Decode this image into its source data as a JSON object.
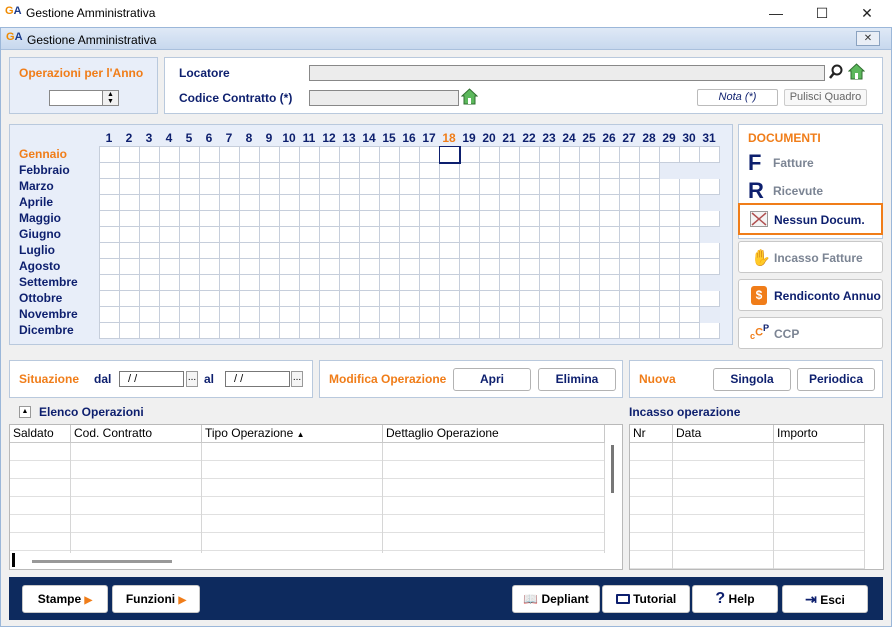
{
  "window": {
    "title": "Gestione Amministrativa",
    "min": "—",
    "max": "☐",
    "close": "✕"
  },
  "inner_window": {
    "title": "Gestione Amministrativa",
    "close": "✕"
  },
  "operazioni_anno": {
    "label": "Operazioni per l'Anno",
    "value": ""
  },
  "header": {
    "locatore_label": "Locatore",
    "locatore_value": "",
    "codice_label": "Codice Contratto (*)",
    "codice_value": "",
    "nota_button": "Nota (*)",
    "pulisci_button": "Pulisci Quadro"
  },
  "calendar": {
    "days": [
      "1",
      "2",
      "3",
      "4",
      "5",
      "6",
      "7",
      "8",
      "9",
      "10",
      "11",
      "12",
      "13",
      "14",
      "15",
      "16",
      "17",
      "18",
      "19",
      "20",
      "21",
      "22",
      "23",
      "24",
      "25",
      "26",
      "27",
      "28",
      "29",
      "30",
      "31"
    ],
    "highlight_day": "18",
    "months": [
      "Gennaio",
      "Febbraio",
      "Marzo",
      "Aprile",
      "Maggio",
      "Giugno",
      "Luglio",
      "Agosto",
      "Settembre",
      "Ottobre",
      "Novembre",
      "Dicembre"
    ],
    "highlight_month": "Gennaio",
    "month_lengths": [
      31,
      28,
      31,
      30,
      31,
      30,
      31,
      31,
      30,
      31,
      30,
      31
    ],
    "selected_day": 18,
    "selected_month": 1
  },
  "documenti": {
    "title": "DOCUMENTI",
    "fatture": "Fatture",
    "ricevute": "Ricevute",
    "nessun": "Nessun Docum.",
    "incasso_fatture": "Incasso Fatture",
    "rendiconto": "Rendiconto Annuo",
    "ccp": "CCP"
  },
  "situazione": {
    "label": "Situazione",
    "dal_label": "dal",
    "dal_value": "/ /",
    "al_label": "al",
    "al_value": "/ /",
    "dots": "..."
  },
  "modifica": {
    "label": "Modifica Operazione",
    "apri": "Apri",
    "elimina": "Elimina"
  },
  "nuova": {
    "label": "Nuova",
    "singola": "Singola",
    "periodica": "Periodica"
  },
  "elenco": {
    "title": "Elenco Operazioni",
    "columns": [
      "Saldato",
      "Cod. Contratto",
      "Tipo Operazione",
      "Dettaglio Operazione"
    ]
  },
  "incasso": {
    "title": "Incasso operazione",
    "columns": [
      "Nr",
      "Data",
      "Importo"
    ]
  },
  "footer": {
    "stampe": "Stampe",
    "funzioni": "Funzioni",
    "depliant": "Depliant",
    "tutorial": "Tutorial",
    "help": "Help",
    "esci": "Esci"
  },
  "colors": {
    "accent_orange": "#f07d19",
    "navy": "#0d1f6e",
    "footer_bg": "#0d2a5e"
  }
}
